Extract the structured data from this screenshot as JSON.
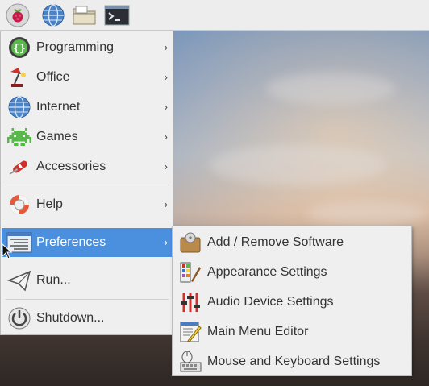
{
  "taskbar": {
    "buttons": [
      {
        "name": "raspberry-menu",
        "icon": "raspberry-icon"
      },
      {
        "name": "web-browser",
        "icon": "globe-icon"
      },
      {
        "name": "file-manager",
        "icon": "folder-icon"
      },
      {
        "name": "terminal",
        "icon": "terminal-icon"
      }
    ]
  },
  "menu": {
    "items": [
      {
        "label": "Programming",
        "icon": "code-braces-icon",
        "submenu": true
      },
      {
        "label": "Office",
        "icon": "desk-lamp-icon",
        "submenu": true
      },
      {
        "label": "Internet",
        "icon": "globe-icon",
        "submenu": true
      },
      {
        "label": "Games",
        "icon": "space-invader-icon",
        "submenu": true
      },
      {
        "label": "Accessories",
        "icon": "swiss-knife-icon",
        "submenu": true
      },
      {
        "label": "Help",
        "icon": "lifebuoy-icon",
        "submenu": true
      },
      {
        "label": "Preferences",
        "icon": "preferences-icon",
        "submenu": true,
        "active": true
      },
      {
        "label": "Run...",
        "icon": "paper-plane-icon",
        "submenu": false
      },
      {
        "label": "Shutdown...",
        "icon": "power-icon",
        "submenu": false
      }
    ],
    "arrow": "›"
  },
  "submenu": {
    "parent": "Preferences",
    "items": [
      {
        "label": "Add / Remove Software",
        "icon": "package-icon"
      },
      {
        "label": "Appearance Settings",
        "icon": "palette-icon"
      },
      {
        "label": "Audio Device Settings",
        "icon": "mixer-sliders-icon"
      },
      {
        "label": "Main Menu Editor",
        "icon": "menu-edit-icon"
      },
      {
        "label": "Mouse and Keyboard Settings",
        "icon": "mouse-keyboard-icon"
      }
    ]
  },
  "colors": {
    "highlight": "#4b8fdf",
    "menu_bg": "#efefef",
    "taskbar_bg": "#ededed"
  }
}
